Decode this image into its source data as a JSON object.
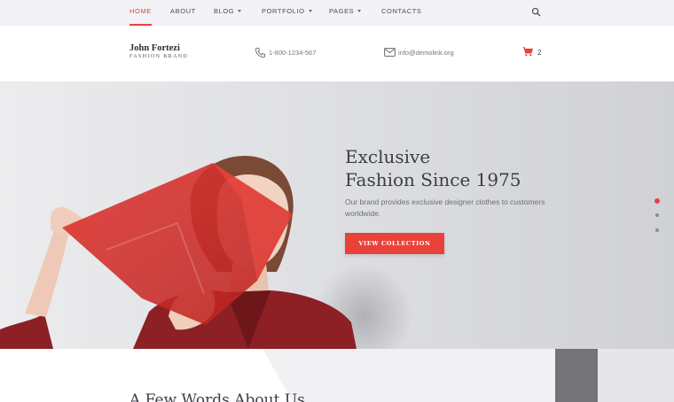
{
  "nav": {
    "items": [
      {
        "label": "Home",
        "active": true,
        "dropdown": false
      },
      {
        "label": "About",
        "active": false,
        "dropdown": false
      },
      {
        "label": "Blog",
        "active": false,
        "dropdown": true
      },
      {
        "label": "Portfolio",
        "active": false,
        "dropdown": true
      },
      {
        "label": "Pages",
        "active": false,
        "dropdown": true
      },
      {
        "label": "Contacts",
        "active": false,
        "dropdown": false
      }
    ],
    "search_icon": "search-icon"
  },
  "header": {
    "brand_name": "John Fortezi",
    "brand_sub": "FASHION BRAND",
    "phone": "1-800-1234-567",
    "email": "info@demolink.org",
    "cart_count": "2",
    "icons": {
      "phone": "phone-icon",
      "email": "mail-icon",
      "cart": "cart-icon"
    }
  },
  "hero": {
    "title_line1": "Exclusive",
    "title_line2": "Fashion Since 1975",
    "description": "Our brand provides exclusive designer clothes to customers worldwide.",
    "button_label": "View Collection",
    "slides": 3,
    "active_slide": 1
  },
  "about": {
    "title": "A Few Words About Us"
  },
  "colors": {
    "accent": "#e8423b",
    "nav_bg": "#f2f2f7",
    "heading": "#3b3d4c"
  }
}
